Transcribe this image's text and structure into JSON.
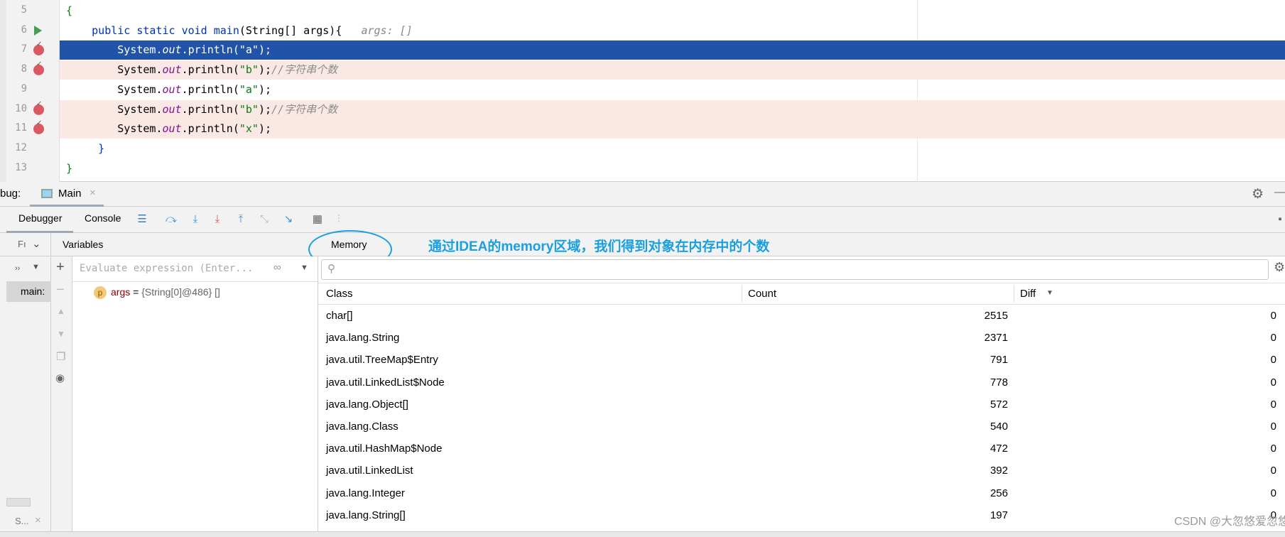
{
  "editor": {
    "lines": [
      {
        "n": "5",
        "segments": [
          {
            "t": "{",
            "c": "str"
          }
        ]
      },
      {
        "n": "6",
        "segments": [
          {
            "t": "    public static void ",
            "c": "kw"
          },
          {
            "t": "main",
            "c": "kw"
          },
          {
            "t": "(String[] args){",
            "c": ""
          },
          {
            "t": "   args: []",
            "c": "hint"
          }
        ],
        "run": true
      },
      {
        "n": "7",
        "segments": [
          {
            "t": "        System.",
            "c": ""
          },
          {
            "t": "out",
            "c": "it"
          },
          {
            "t": ".println(\"a\");",
            "c": ""
          }
        ],
        "bp": true,
        "current": true
      },
      {
        "n": "8",
        "segments": [
          {
            "t": "        System.",
            "c": ""
          },
          {
            "t": "out",
            "c": "it"
          },
          {
            "t": ".println(",
            "c": ""
          },
          {
            "t": "\"b\"",
            "c": "str"
          },
          {
            "t": ");",
            "c": ""
          },
          {
            "t": "//字符串个数",
            "c": "cm"
          }
        ],
        "bp": true
      },
      {
        "n": "9",
        "segments": [
          {
            "t": "        System.",
            "c": ""
          },
          {
            "t": "out",
            "c": "it"
          },
          {
            "t": ".println(",
            "c": ""
          },
          {
            "t": "\"a\"",
            "c": "str"
          },
          {
            "t": ");",
            "c": ""
          }
        ]
      },
      {
        "n": "10",
        "segments": [
          {
            "t": "        System.",
            "c": ""
          },
          {
            "t": "out",
            "c": "it"
          },
          {
            "t": ".println(",
            "c": ""
          },
          {
            "t": "\"b\"",
            "c": "str"
          },
          {
            "t": ");",
            "c": ""
          },
          {
            "t": "//字符串个数",
            "c": "cm"
          }
        ],
        "bp": true
      },
      {
        "n": "11",
        "segments": [
          {
            "t": "        System.",
            "c": ""
          },
          {
            "t": "out",
            "c": "it"
          },
          {
            "t": ".println(",
            "c": ""
          },
          {
            "t": "\"x\"",
            "c": "str"
          },
          {
            "t": ");",
            "c": ""
          }
        ],
        "bp": true
      },
      {
        "n": "12",
        "segments": [
          {
            "t": "     }",
            "c": "kw"
          }
        ]
      },
      {
        "n": "13",
        "segments": [
          {
            "t": "}",
            "c": "str"
          }
        ]
      }
    ]
  },
  "debug": {
    "label": "bug:",
    "session_tab": "Main",
    "tabs": [
      "Debugger",
      "Console"
    ]
  },
  "frames": {
    "header": "Fı",
    "item": "main:",
    "bottom": "S..."
  },
  "variables": {
    "header": "Variables",
    "eval_placeholder": "Evaluate expression (Enter...",
    "var_name": "args",
    "var_eq": " = ",
    "var_value": "{String[0]@486} []",
    "var_badge": "p"
  },
  "memory": {
    "tab": "Memory",
    "annotation": "通过IDEA的memory区域，我们得到对象在内存中的个数",
    "columns": [
      "Class",
      "Count",
      "Diff"
    ],
    "rows": [
      [
        "char[]",
        "2515",
        "0"
      ],
      [
        "java.lang.String",
        "2371",
        "0"
      ],
      [
        "java.util.TreeMap$Entry",
        "791",
        "0"
      ],
      [
        "java.util.LinkedList$Node",
        "778",
        "0"
      ],
      [
        "java.lang.Object[]",
        "572",
        "0"
      ],
      [
        "java.lang.Class",
        "540",
        "0"
      ],
      [
        "java.util.HashMap$Node",
        "472",
        "0"
      ],
      [
        "java.util.LinkedList",
        "392",
        "0"
      ],
      [
        "java.lang.Integer",
        "256",
        "0"
      ],
      [
        "java.lang.String[]",
        "197",
        "0"
      ]
    ]
  },
  "watermark": "CSDN @大忽悠爱忽悠",
  "colors": {
    "accent": "#2154a6",
    "annotation": "#1aa0e0",
    "breakpoint": "#db5860"
  }
}
